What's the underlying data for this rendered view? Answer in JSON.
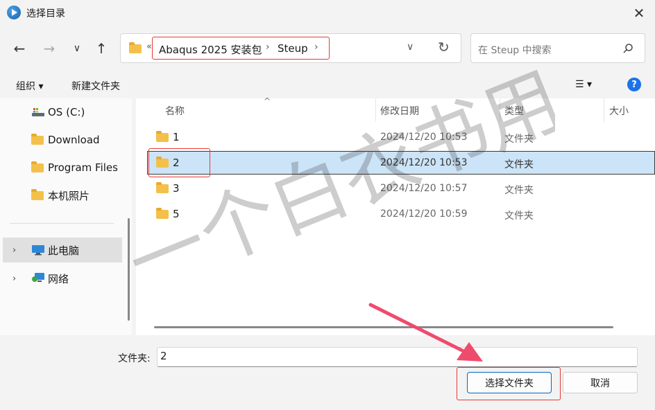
{
  "window": {
    "title": "选择目录",
    "close_glyph": "✕"
  },
  "nav": {
    "back": "←",
    "forward": "→",
    "recent": "∨",
    "up": "↑"
  },
  "address": {
    "overflow": "«",
    "crumbs": [
      "Abaqus 2025 安装包",
      "Steup"
    ],
    "sep": "›",
    "dropdown": "∨",
    "refresh": "↻"
  },
  "search": {
    "placeholder": "在 Steup 中搜索",
    "icon": "search-icon"
  },
  "toolbar": {
    "organize": "组织 ▾",
    "new_folder": "新建文件夹",
    "view": "☰ ▾",
    "help": "?"
  },
  "sidebar": {
    "items": [
      {
        "label": "OS (C:)",
        "icon": "drive-icon"
      },
      {
        "label": "Download",
        "icon": "folder-icon"
      },
      {
        "label": "Program Files",
        "icon": "folder-icon"
      },
      {
        "label": "本机照片",
        "icon": "folder-icon"
      },
      {
        "label": "此电脑",
        "icon": "computer-icon",
        "expand": "›"
      },
      {
        "label": "网络",
        "icon": "network-icon",
        "expand": "›"
      }
    ]
  },
  "columns": {
    "name": "名称",
    "sort": "^",
    "modified": "修改日期",
    "type": "类型",
    "size": "大小"
  },
  "files": [
    {
      "name": "1",
      "modified": "2024/12/20 10:53",
      "type": "文件夹"
    },
    {
      "name": "2",
      "modified": "2024/12/20 10:53",
      "type": "文件夹",
      "selected": true
    },
    {
      "name": "3",
      "modified": "2024/12/20 10:57",
      "type": "文件夹"
    },
    {
      "name": "5",
      "modified": "2024/12/20 10:59",
      "type": "文件夹"
    }
  ],
  "bottom": {
    "folder_label": "文件夹:",
    "folder_value": "2",
    "select_button": "选择文件夹",
    "cancel_button": "取消"
  },
  "watermark": "一个白衣书用",
  "colors": {
    "accent": "#0067c0",
    "selection": "#cce4f7",
    "annotation": "#e53935"
  }
}
